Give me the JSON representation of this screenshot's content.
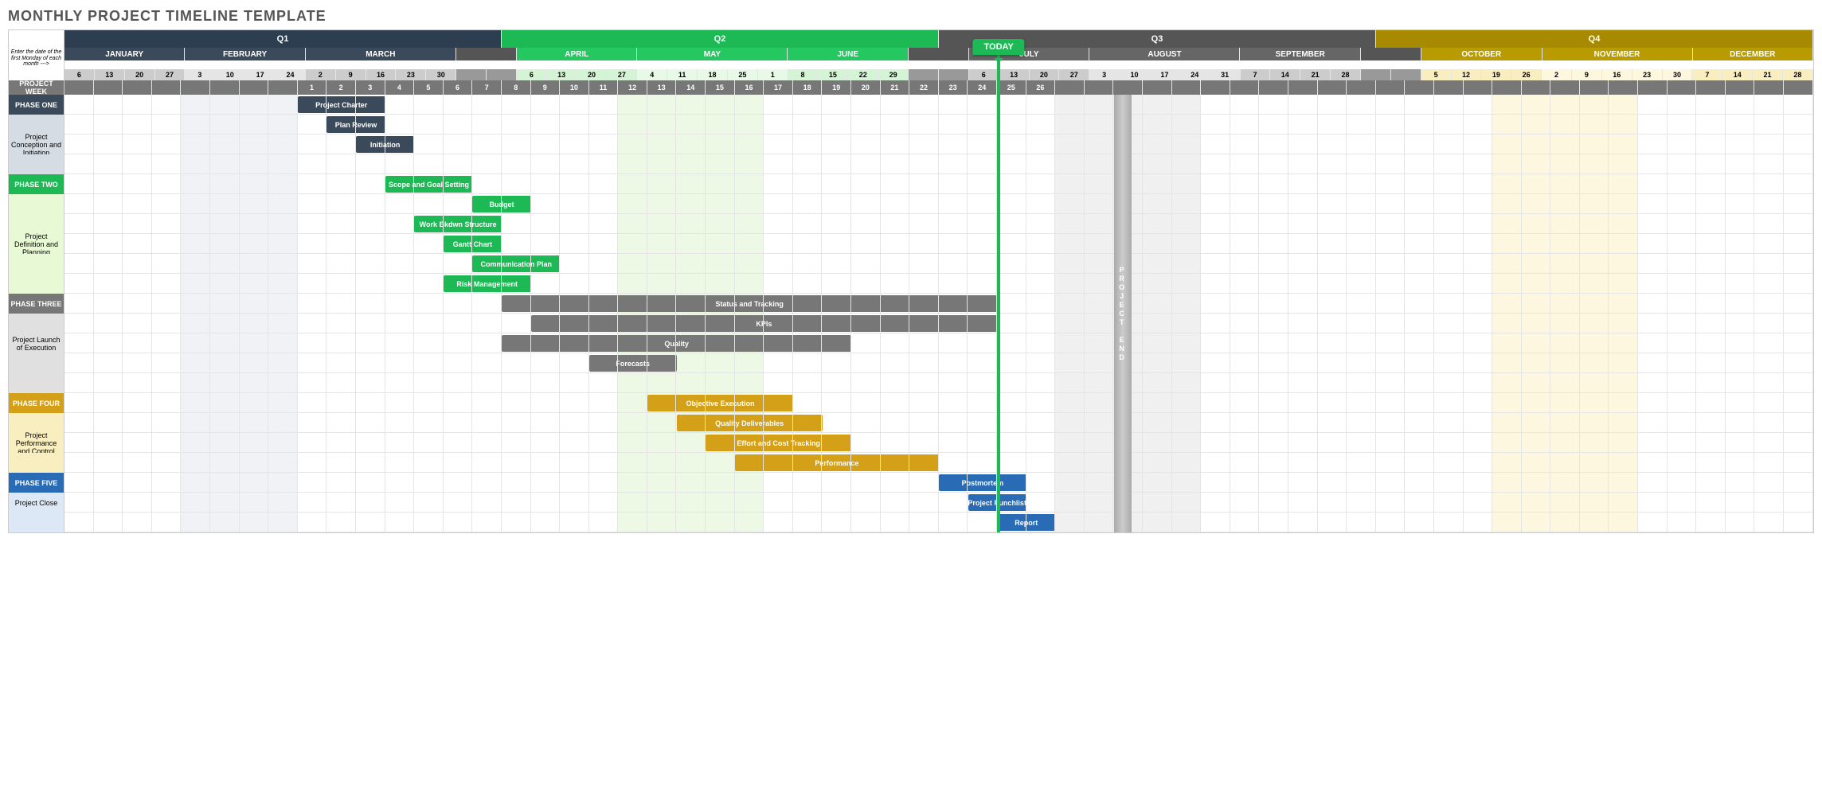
{
  "title": "MONTHLY PROJECT TIMELINE TEMPLATE",
  "corner_note": "Enter the date of the first Monday of each month --->",
  "project_week_label": "PROJECT WEEK",
  "today_label": "TODAY",
  "project_end_label": "PROJECT END",
  "today_col": 32,
  "project_end_col": 36,
  "total_cols": 60,
  "quarters": [
    {
      "label": "Q1",
      "span": 15,
      "bg": "#2c3e50"
    },
    {
      "label": "Q2",
      "span": 15,
      "bg": "#1DB954"
    },
    {
      "label": "Q3",
      "span": 15,
      "bg": "#555"
    },
    {
      "label": "Q4",
      "span": 15,
      "bg": "#a88a00"
    }
  ],
  "months": [
    {
      "label": "JANUARY",
      "span": 4,
      "bg": "#3a4a5a",
      "dbg": "#ccc"
    },
    {
      "label": "FEBRUARY",
      "span": 4,
      "bg": "#3a4a5a",
      "dbg": "#e5e5e5"
    },
    {
      "label": "MARCH",
      "span": 5,
      "bg": "#3a4a5a",
      "dbg": "#ccc"
    },
    {
      "label": "",
      "span": 2,
      "bg": "#555",
      "dbg": "#999"
    },
    {
      "label": "APRIL",
      "span": 4,
      "bg": "#25c760",
      "dbg": "#d5f4d5"
    },
    {
      "label": "MAY",
      "span": 5,
      "bg": "#25c760",
      "dbg": "#e8f9e8"
    },
    {
      "label": "JUNE",
      "span": 4,
      "bg": "#25c760",
      "dbg": "#d5f4d5"
    },
    {
      "label": "",
      "span": 2,
      "bg": "#555",
      "dbg": "#999"
    },
    {
      "label": "JULY",
      "span": 4,
      "bg": "#666",
      "dbg": "#ccc"
    },
    {
      "label": "AUGUST",
      "span": 5,
      "bg": "#666",
      "dbg": "#e5e5e5"
    },
    {
      "label": "SEPTEMBER",
      "span": 4,
      "bg": "#666",
      "dbg": "#ccc"
    },
    {
      "label": "",
      "span": 2,
      "bg": "#555",
      "dbg": "#999"
    },
    {
      "label": "OCTOBER",
      "span": 4,
      "bg": "#b89b00",
      "dbg": "#f9eec0"
    },
    {
      "label": "NOVEMBER",
      "span": 5,
      "bg": "#b89b00",
      "dbg": "#fdf7e0"
    },
    {
      "label": "DECEMBER",
      "span": 4,
      "bg": "#b89b00",
      "dbg": "#f9eec0"
    }
  ],
  "dates": [
    "6",
    "13",
    "20",
    "27",
    "3",
    "10",
    "17",
    "24",
    "2",
    "9",
    "16",
    "23",
    "30",
    "",
    "",
    "6",
    "13",
    "20",
    "27",
    "4",
    "11",
    "18",
    "25",
    "1",
    "8",
    "15",
    "22",
    "29",
    "",
    "",
    "6",
    "13",
    "20",
    "27",
    "3",
    "10",
    "17",
    "24",
    "31",
    "7",
    "14",
    "21",
    "28",
    "",
    "",
    "5",
    "12",
    "19",
    "26",
    "2",
    "9",
    "16",
    "23",
    "30",
    "7",
    "14",
    "21",
    "28",
    "",
    ""
  ],
  "weeks": [
    "",
    "",
    "",
    "",
    "",
    "",
    "",
    "",
    "1",
    "2",
    "3",
    "4",
    "5",
    "6",
    "7",
    "8",
    "9",
    "10",
    "11",
    "12",
    "13",
    "14",
    "15",
    "16",
    "17",
    "18",
    "19",
    "20",
    "21",
    "22",
    "23",
    "24",
    "25",
    "26",
    "",
    "",
    "",
    "",
    "",
    "",
    "",
    "",
    "",
    "",
    "",
    "",
    "",
    "",
    "",
    "",
    "",
    "",
    "",
    "",
    "",
    "",
    "",
    "",
    "",
    ""
  ],
  "chart_data": {
    "type": "gantt",
    "phases": [
      {
        "id": "PHASE ONE",
        "sub": "Project Conception and Initiation",
        "color": "#3a4a5a",
        "label_bg": "#3a4a5a",
        "sub_bg": "#d5dce3",
        "rows": 4,
        "tasks": [
          {
            "label": "Project Charter",
            "start": 8,
            "span": 3,
            "row": 0
          },
          {
            "label": "Plan Review",
            "start": 9,
            "span": 2,
            "row": 1
          },
          {
            "label": "Initiation",
            "start": 10,
            "span": 2,
            "row": 2
          }
        ]
      },
      {
        "id": "PHASE TWO",
        "sub": "Project Definition and Planning",
        "color": "#1DB954",
        "label_bg": "#1DB954",
        "sub_bg": "#e8f9d5",
        "rows": 6,
        "tasks": [
          {
            "label": "Scope and Goal Setting",
            "start": 11,
            "span": 3,
            "row": 0
          },
          {
            "label": "Budget",
            "start": 14,
            "span": 2,
            "row": 1
          },
          {
            "label": "Work Bkdwn Structure",
            "start": 12,
            "span": 3,
            "row": 2
          },
          {
            "label": "Gantt Chart",
            "start": 13,
            "span": 2,
            "row": 3
          },
          {
            "label": "Communication Plan",
            "start": 14,
            "span": 3,
            "row": 4
          },
          {
            "label": "Risk Management",
            "start": 13,
            "span": 3,
            "row": 5
          }
        ]
      },
      {
        "id": "PHASE THREE",
        "sub": "Project Launch of Execution",
        "color": "#777",
        "label_bg": "#777",
        "sub_bg": "#e0e0e0",
        "rows": 5,
        "tasks": [
          {
            "label": "Status  and Tracking",
            "start": 15,
            "span": 17,
            "row": 0
          },
          {
            "label": "KPIs",
            "start": 16,
            "span": 16,
            "row": 1
          },
          {
            "label": "Quality",
            "start": 15,
            "span": 12,
            "row": 2
          },
          {
            "label": "Forecasts",
            "start": 18,
            "span": 3,
            "row": 3
          }
        ]
      },
      {
        "id": "PHASE FOUR",
        "sub": "Project Performance and Control",
        "color": "#d4a017",
        "label_bg": "#d4a017",
        "sub_bg": "#f9eec0",
        "rows": 4,
        "tasks": [
          {
            "label": "Objective Execution",
            "start": 20,
            "span": 5,
            "row": 0
          },
          {
            "label": "Quality Deliverables",
            "start": 21,
            "span": 5,
            "row": 1
          },
          {
            "label": "Effort and Cost Tracking",
            "start": 22,
            "span": 5,
            "row": 2
          },
          {
            "label": "Performance",
            "start": 23,
            "span": 7,
            "row": 3
          }
        ]
      },
      {
        "id": "PHASE FIVE",
        "sub": "Project Close",
        "color": "#2a6bb5",
        "label_bg": "#2a6bb5",
        "sub_bg": "#dce8f5",
        "rows": 3,
        "tasks": [
          {
            "label": "Postmortem",
            "start": 30,
            "span": 3,
            "row": 0
          },
          {
            "label": "Project Punchlist",
            "start": 31,
            "span": 2,
            "row": 1
          },
          {
            "label": "Report",
            "start": 32,
            "span": 2,
            "row": 2
          }
        ]
      }
    ]
  },
  "col_shades": [
    {
      "start": 4,
      "span": 4,
      "color": "#f0f2f5"
    },
    {
      "start": 19,
      "span": 5,
      "color": "#eef9e5"
    },
    {
      "start": 34,
      "span": 5,
      "color": "#f0f0f0"
    },
    {
      "start": 49,
      "span": 5,
      "color": "#fdf7e0"
    }
  ]
}
